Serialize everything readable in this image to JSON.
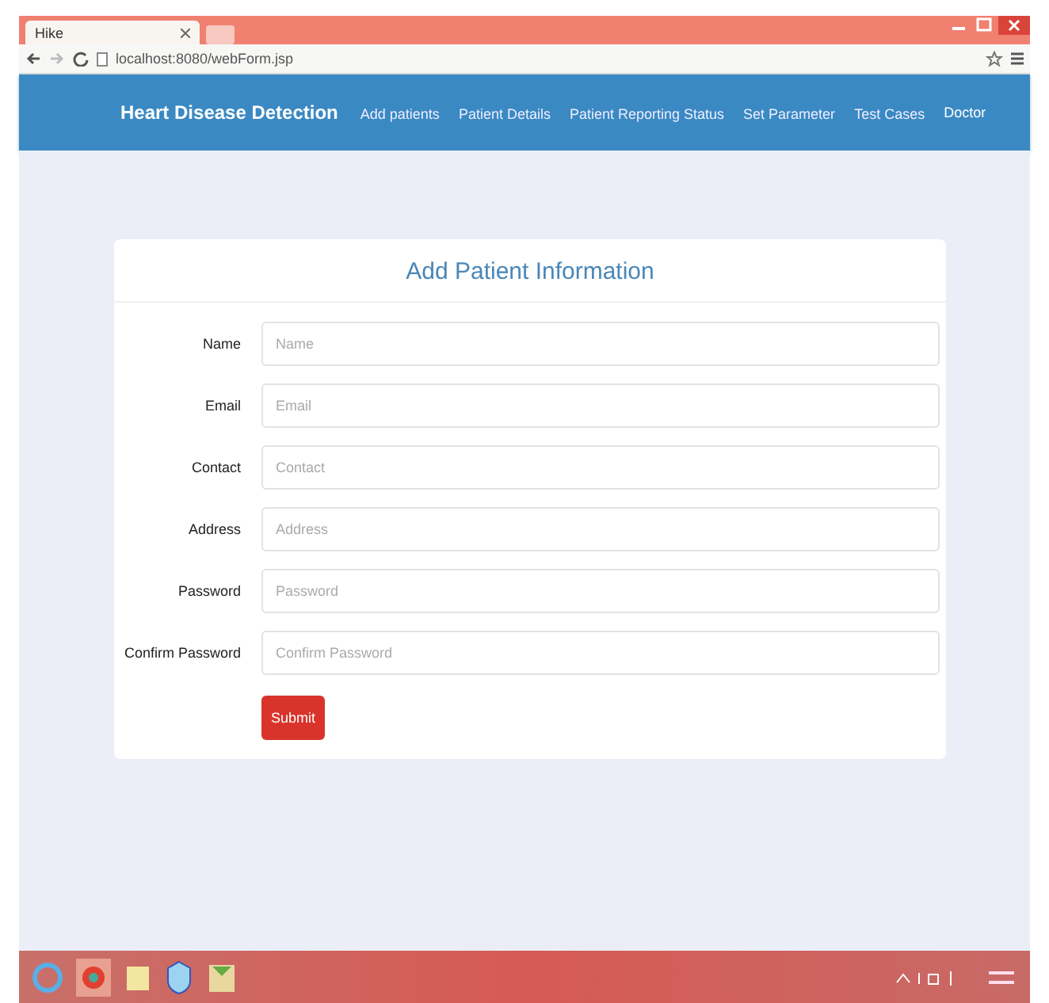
{
  "browser": {
    "tab_title": "Hike",
    "address": "localhost:8080/webForm.jsp"
  },
  "navbar": {
    "brand": "Heart Disease Detection",
    "links": [
      {
        "label": "Add patients"
      },
      {
        "label": "Patient Details"
      },
      {
        "label": "Patient Reporting Status"
      },
      {
        "label": "Set Parameter"
      },
      {
        "label": "Test Cases"
      }
    ],
    "user": "Doctor"
  },
  "form": {
    "title": "Add Patient Information",
    "fields": [
      {
        "label": "Name",
        "placeholder": "Name"
      },
      {
        "label": "Email",
        "placeholder": "Email"
      },
      {
        "label": "Contact",
        "placeholder": "Contact"
      },
      {
        "label": "Address",
        "placeholder": "Address"
      },
      {
        "label": "Password",
        "placeholder": "Password"
      },
      {
        "label": "Confirm Password",
        "placeholder": "Confirm Password"
      }
    ],
    "submit": "Submit"
  }
}
